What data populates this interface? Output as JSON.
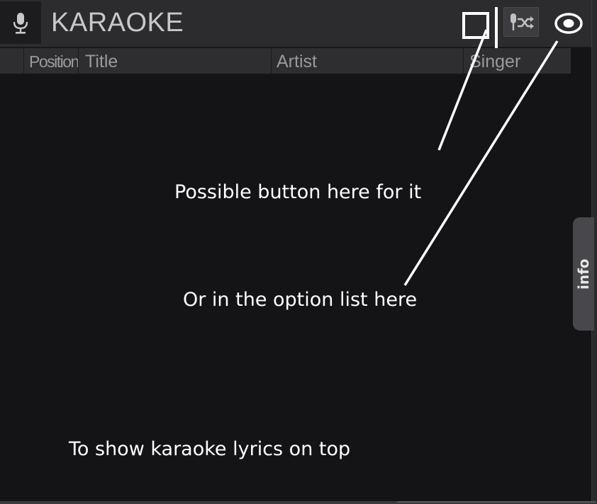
{
  "panel": {
    "title": "KARAOKE",
    "icons": {
      "mic": "microphone-icon",
      "shuffle": "mic-shuffle-icon",
      "options": "eye-icon"
    }
  },
  "columns": [
    {
      "key": "position",
      "label": "Position"
    },
    {
      "key": "title",
      "label": "Title"
    },
    {
      "key": "artist",
      "label": "Artist"
    },
    {
      "key": "singer",
      "label": "Singer"
    }
  ],
  "side_tab": {
    "label": "info"
  },
  "annotations": {
    "button_note": "Possible button here for it",
    "options_note": "Or in the option list here",
    "lyrics_note": "To show karaoke lyrics on top"
  },
  "colors": {
    "background": "#141416",
    "header": "#2c2c2f",
    "annotation": "#ffffff"
  }
}
